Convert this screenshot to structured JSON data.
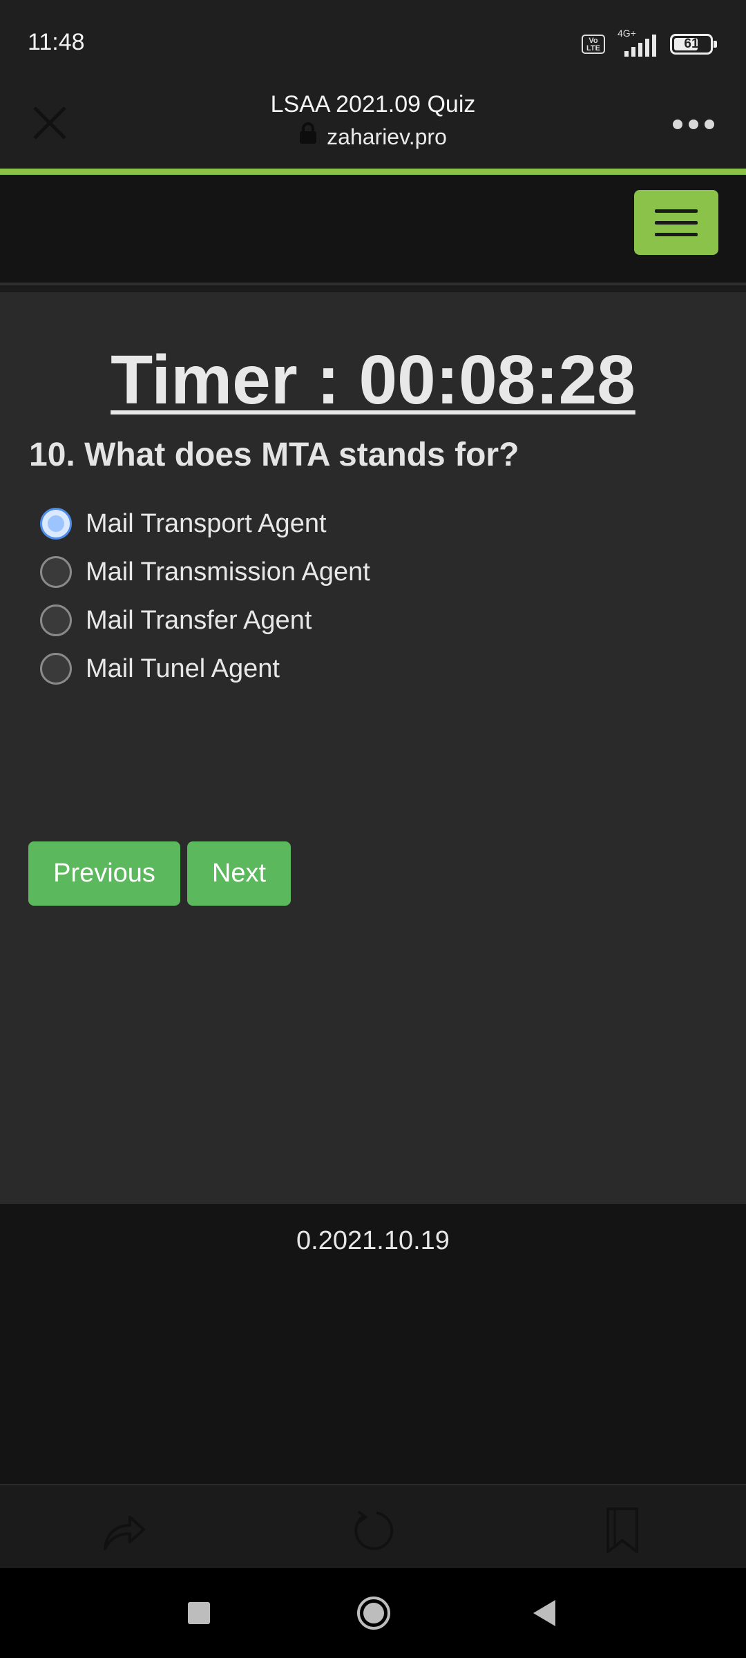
{
  "status_bar": {
    "time": "11:48",
    "volte_label": "Vo LTE",
    "network_type": "4G+",
    "battery_level": "61"
  },
  "browser": {
    "title": "LSAA 2021.09 Quiz",
    "url": "zahariev.pro",
    "close_icon": "close-icon",
    "more_icon": "more-options-icon",
    "accent_color": "#8bc34a"
  },
  "site_nav": {
    "menu_icon": "hamburger-menu-icon"
  },
  "quiz": {
    "timer_text": "Timer : 00:08:28",
    "question": "10. What does MTA stands for?",
    "options": [
      {
        "label": "Mail Transport Agent",
        "selected": true
      },
      {
        "label": "Mail Transmission Agent",
        "selected": false
      },
      {
        "label": "Mail Transfer Agent",
        "selected": false
      },
      {
        "label": "Mail Tunel Agent",
        "selected": false
      }
    ],
    "previous_label": "Previous",
    "next_label": "Next",
    "button_color": "#5cb85c"
  },
  "footer": {
    "version": "0.2021.10.19"
  },
  "browser_toolbar": {
    "share_icon": "share-icon",
    "reload_icon": "reload-icon",
    "bookmark_icon": "bookmark-icon"
  },
  "system_nav": {
    "recents_icon": "recents-icon",
    "home_icon": "home-icon",
    "back_icon": "back-icon"
  }
}
